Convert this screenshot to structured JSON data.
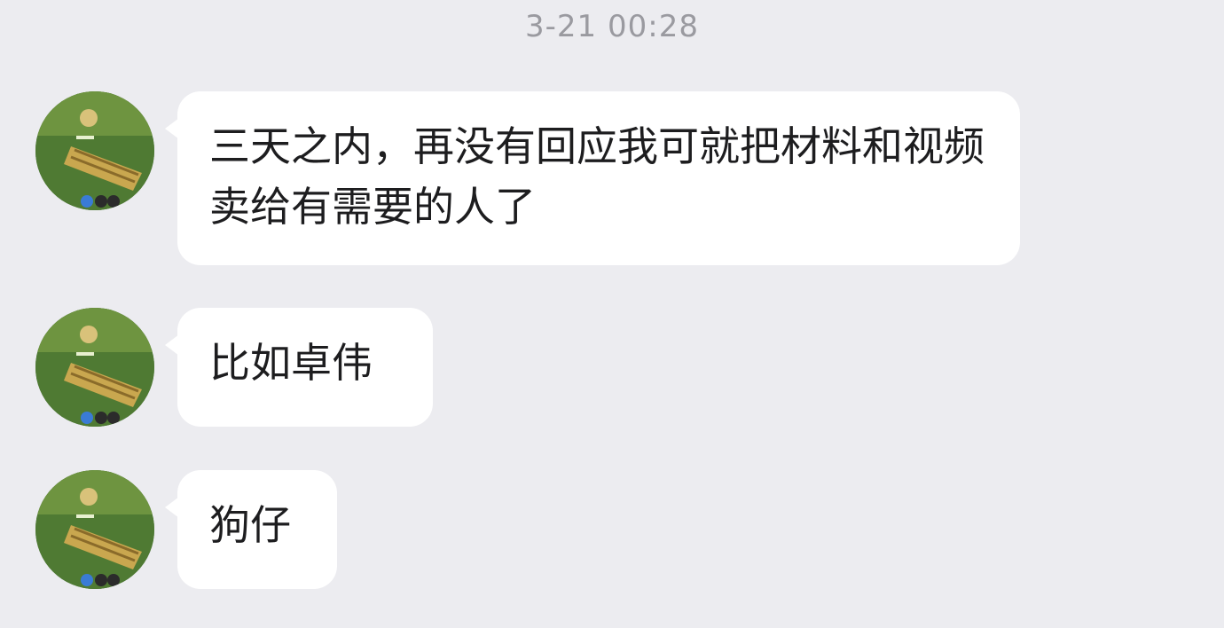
{
  "chat": {
    "timestamp": "3-21 00:28",
    "messages": [
      {
        "sender": "contact",
        "avatar_icon": "game-avatar-icon",
        "text": "三天之内，再没有回应我可就把材料和视频卖给有需要的人了"
      },
      {
        "sender": "contact",
        "avatar_icon": "game-avatar-icon",
        "text": "比如卓伟"
      },
      {
        "sender": "contact",
        "avatar_icon": "game-avatar-icon",
        "text": "狗仔"
      }
    ]
  },
  "colors": {
    "background": "#ececf0",
    "bubble": "#ffffff",
    "text": "#1d1d1f",
    "timestamp": "#9a9aa0"
  }
}
